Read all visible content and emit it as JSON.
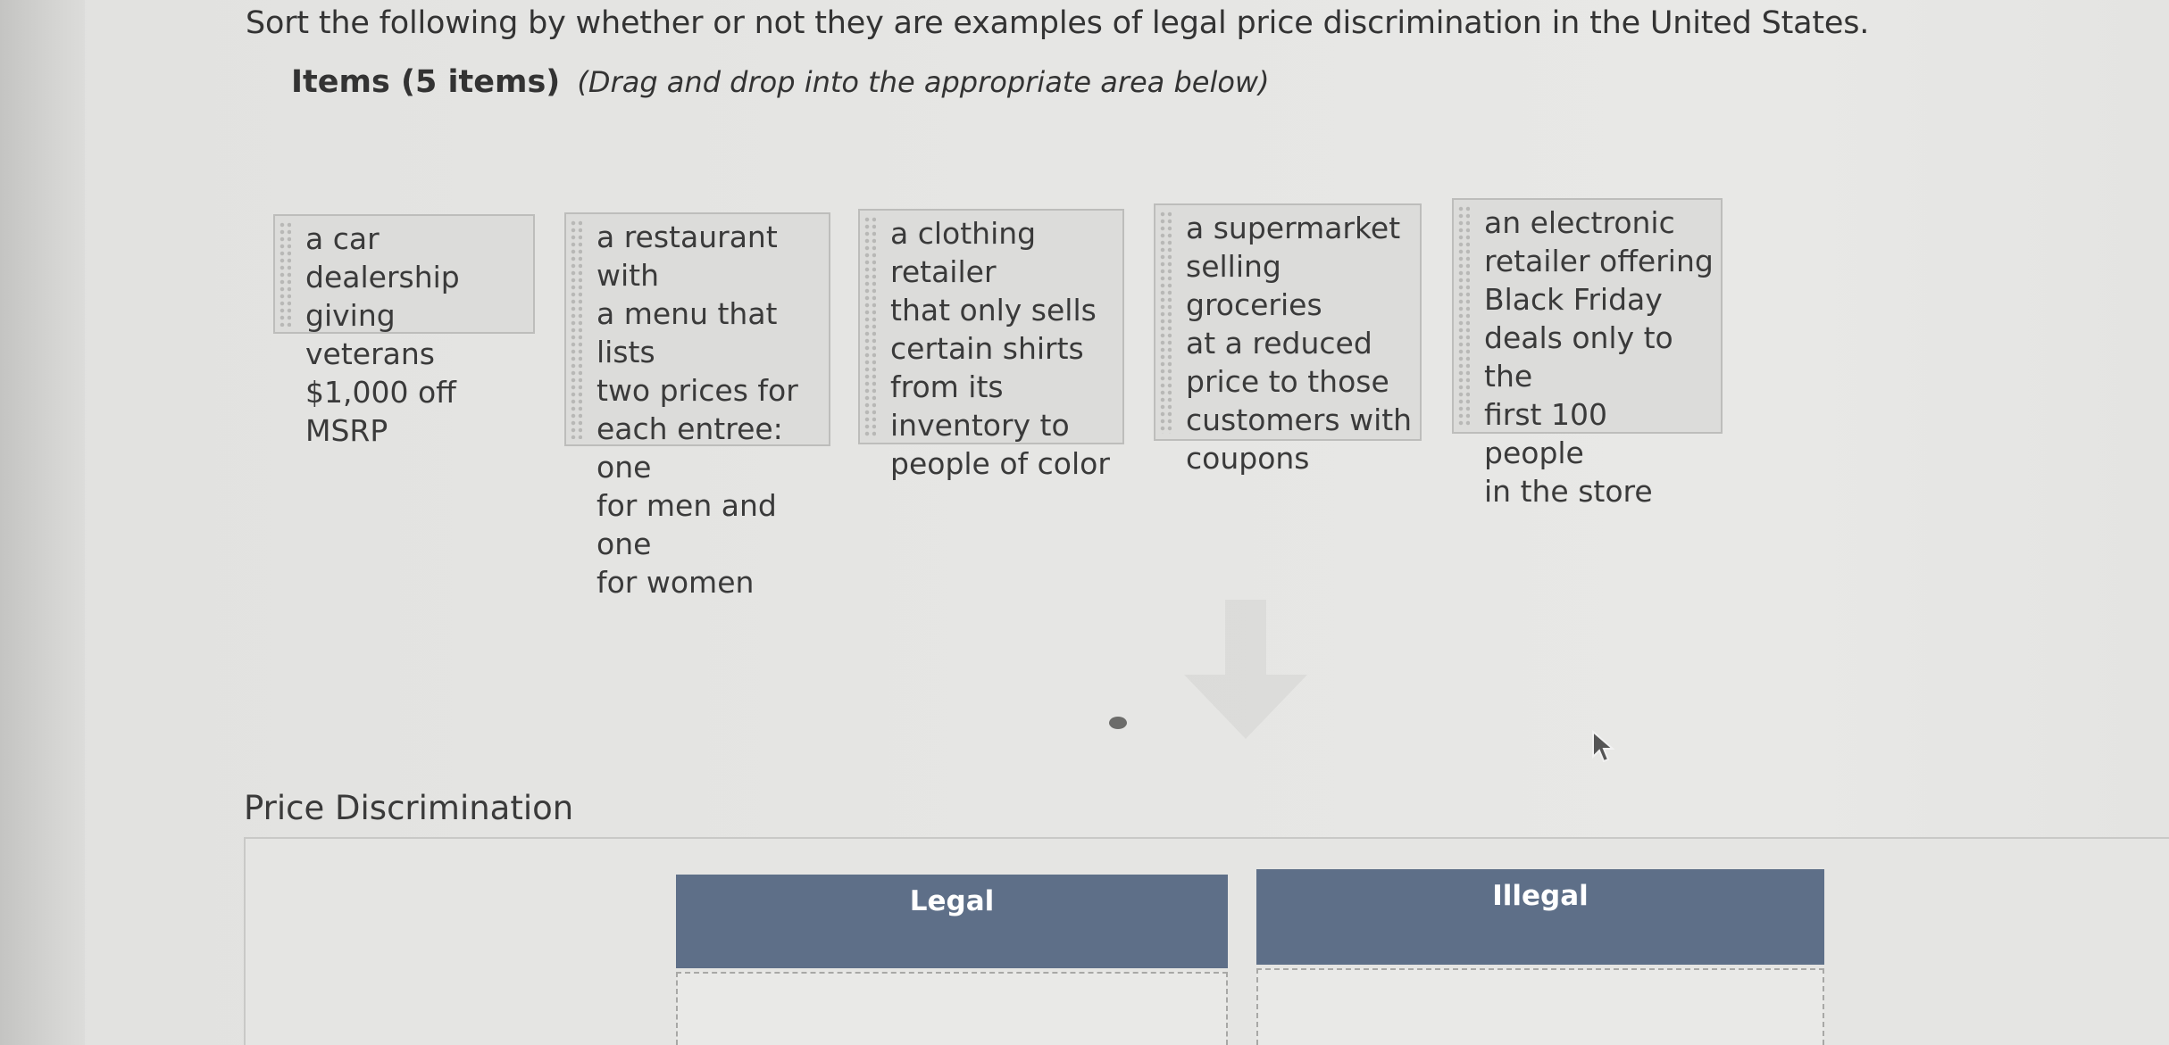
{
  "question": "Sort the following by whether or not they are examples of legal price discrimination in the United States.",
  "items_heading": {
    "label": "Items (5 items)",
    "hint": "(Drag and drop into the appropriate area below)"
  },
  "items": [
    {
      "text": "a car dealership giving veterans $1,000 off MSRP",
      "lines": [
        "a car dealership",
        "giving veterans",
        "$1,000 off MSRP"
      ]
    },
    {
      "text": "a restaurant with a menu that lists two prices for each entree: one for men and one for women",
      "lines": [
        "a restaurant with",
        "a menu that lists",
        "two prices for",
        "each entree: one",
        "for men and one",
        "for women"
      ]
    },
    {
      "text": "a clothing retailer that only sells certain shirts from its inventory to people of color",
      "lines": [
        "a clothing retailer",
        "that only sells",
        "certain shirts",
        "from its",
        "inventory to",
        "people of color"
      ]
    },
    {
      "text": "a supermarket selling groceries at a reduced price to those customers with coupons",
      "lines": [
        "a supermarket",
        "selling groceries",
        "at a reduced",
        "price to those",
        "customers with",
        "coupons"
      ]
    },
    {
      "text": "an electronic retailer offering Black Friday deals only to the first 100 people in the store",
      "lines": [
        "an electronic",
        "retailer offering",
        "Black Friday",
        "deals only to the",
        "first 100 people",
        "in the store"
      ]
    }
  ],
  "drop_section": {
    "title": "Price Discrimination",
    "buckets": [
      {
        "label": "Legal"
      },
      {
        "label": "Illegal"
      }
    ]
  },
  "colors": {
    "bucket_header": "#5e6f88",
    "card_bg": "#dcdcda"
  },
  "icons": {
    "arrow": "arrow-down-icon",
    "cursor": "mouse-cursor-icon",
    "grip": "drag-handle-icon"
  }
}
